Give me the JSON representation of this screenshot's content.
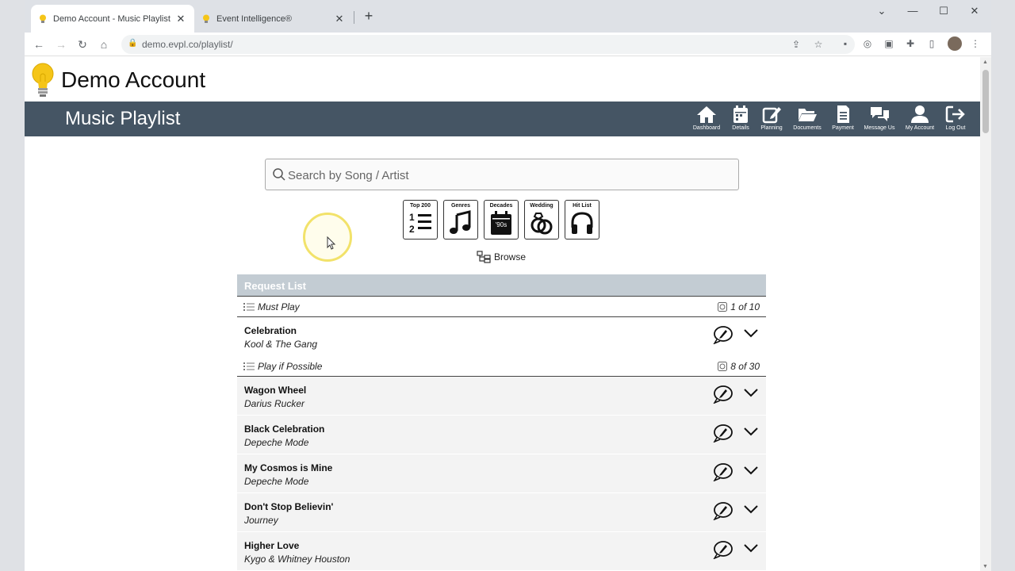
{
  "browser": {
    "tabs": [
      {
        "title": "Demo Account - Music Playlist",
        "close": "✕",
        "active": true
      },
      {
        "title": "Event Intelligence®",
        "close": "✕",
        "active": false
      }
    ],
    "new_tab": "+",
    "url": "demo.evpl.co/playlist/"
  },
  "site": {
    "account_name": "Demo Account",
    "page_title": "Music Playlist",
    "nav": [
      {
        "label": "Dashboard",
        "icon": "home-icon"
      },
      {
        "label": "Details",
        "icon": "calendar-icon"
      },
      {
        "label": "Planning",
        "icon": "edit-icon"
      },
      {
        "label": "Documents",
        "icon": "folder-icon"
      },
      {
        "label": "Payment",
        "icon": "receipt-icon"
      },
      {
        "label": "Message Us",
        "icon": "chat-icon"
      },
      {
        "label": "My Account",
        "icon": "user-icon"
      },
      {
        "label": "Log Out",
        "icon": "logout-icon"
      }
    ],
    "accent_color": "#455564"
  },
  "search": {
    "placeholder": "Search by Song / Artist"
  },
  "browse_buttons": [
    {
      "label": "Top 200",
      "icon": "numbered-list-icon"
    },
    {
      "label": "Genres",
      "icon": "music-note-icon"
    },
    {
      "label": "Decades",
      "icon": "calendar-decade-icon",
      "badge": "'90s"
    },
    {
      "label": "Wedding",
      "icon": "rings-icon"
    },
    {
      "label": "Hit List",
      "icon": "headphones-icon"
    }
  ],
  "browse_label": "Browse",
  "request_list": {
    "header": "Request List",
    "groups": [
      {
        "name": "Must Play",
        "count": "1 of 10"
      },
      {
        "name": "Play if Possible",
        "count": "8 of 30"
      }
    ],
    "songs": [
      {
        "title": "Celebration",
        "artist": "Kool & The Gang"
      },
      {
        "title": "Wagon Wheel",
        "artist": "Darius Rucker"
      },
      {
        "title": "Black Celebration",
        "artist": "Depeche Mode"
      },
      {
        "title": "My Cosmos is Mine",
        "artist": "Depeche Mode"
      },
      {
        "title": "Don't Stop Believin'",
        "artist": "Journey"
      },
      {
        "title": "Higher Love",
        "artist": "Kygo & Whitney Houston"
      }
    ]
  }
}
